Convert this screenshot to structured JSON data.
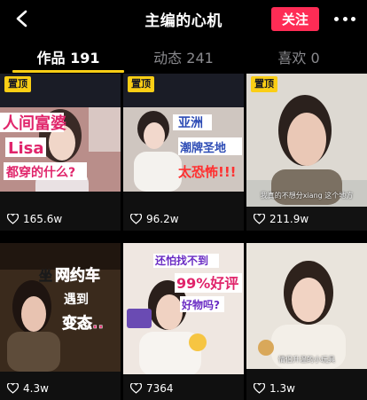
{
  "nav": {
    "title": "主编的心机",
    "follow_label": "关注"
  },
  "tabs": [
    {
      "label": "作品 191",
      "active": true
    },
    {
      "label": "动态 241",
      "active": false
    },
    {
      "label": "喜欢 0",
      "active": false
    }
  ],
  "pin_label": "置顶",
  "videos": [
    {
      "views": "165.6w",
      "pinned": true,
      "caption_lines": [
        "人间富婆",
        "Lisa",
        "都穿的什么?"
      ]
    },
    {
      "views": "96.2w",
      "pinned": true,
      "caption_lines": [
        "亚洲",
        "潮牌圣地",
        "太恐怖!!!"
      ]
    },
    {
      "views": "211.9w",
      "pinned": true,
      "subtitle": "我真的不想分xiang 这个地方"
    },
    {
      "views": "4.3w",
      "pinned": false,
      "caption_lines": [
        "坐",
        "网约车",
        "遇到",
        "变态.."
      ]
    },
    {
      "views": "7364",
      "pinned": false,
      "caption_lines": [
        "还怕找不到",
        "99%好评",
        "好物吗?"
      ]
    },
    {
      "views": "1.3w",
      "pinned": false,
      "subtitle": "情侣升温的小玩具"
    }
  ],
  "colors": {
    "accent": "#fe2c55",
    "tab_indicator": "#face15"
  }
}
